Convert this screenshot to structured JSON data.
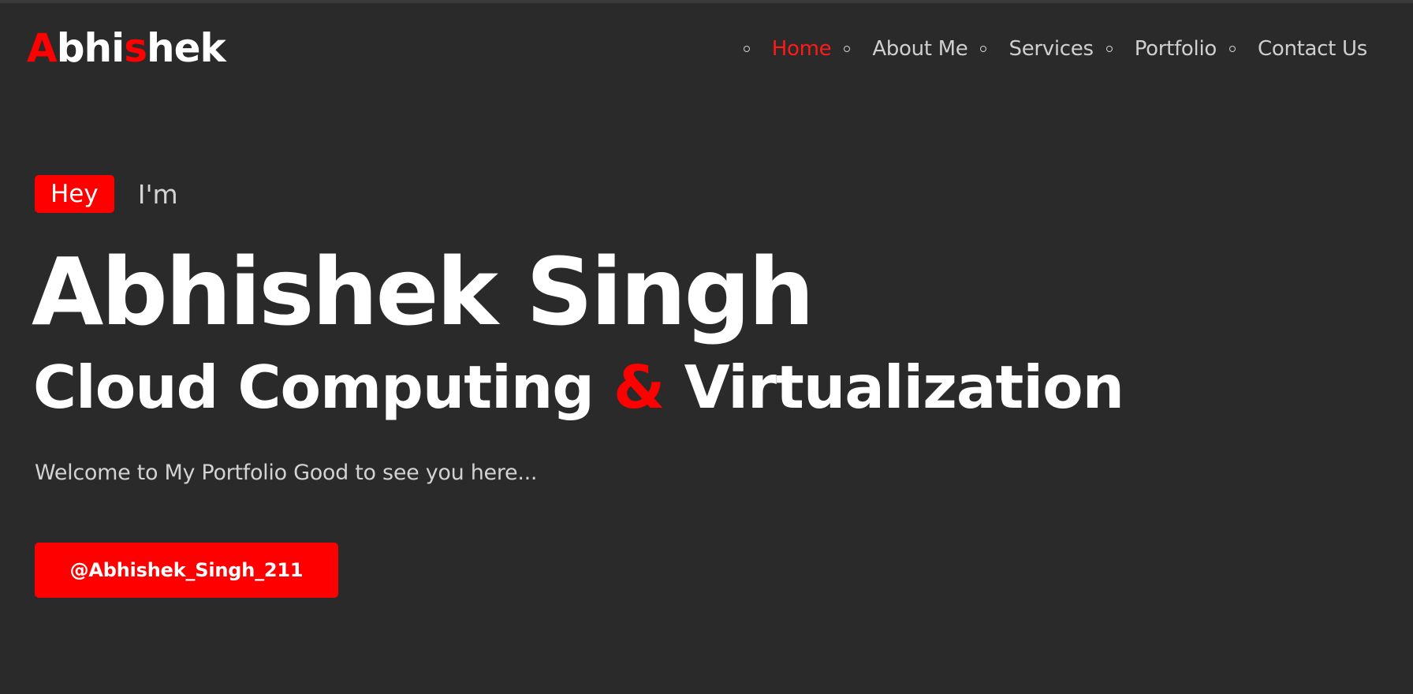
{
  "header": {
    "logo": {
      "letters": [
        {
          "char": "A",
          "color": "red"
        },
        {
          "char": "bhi",
          "color": "white"
        },
        {
          "char": "s",
          "color": "red"
        },
        {
          "char": "hek",
          "color": "white"
        }
      ]
    },
    "nav": {
      "items": [
        {
          "label": "Home",
          "active": true
        },
        {
          "label": "About Me",
          "active": false
        },
        {
          "label": "Services",
          "active": false
        },
        {
          "label": "Portfolio",
          "active": false
        },
        {
          "label": "Contact Us",
          "active": false
        }
      ]
    }
  },
  "hero": {
    "badge": "Hey",
    "intro": "I'm",
    "name": "Abhishek Singh",
    "subtitle_left": "Cloud Computing",
    "subtitle_amp": "&",
    "subtitle_right": "Virtualization",
    "welcome": "Welcome to My Portfolio Good to see you here...",
    "button_label": "@Abhishek_Singh_211"
  },
  "colors": {
    "background": "#2a2a2a",
    "accent": "#ff0000",
    "text": "#ffffff",
    "muted_text": "#d2d2d2"
  }
}
